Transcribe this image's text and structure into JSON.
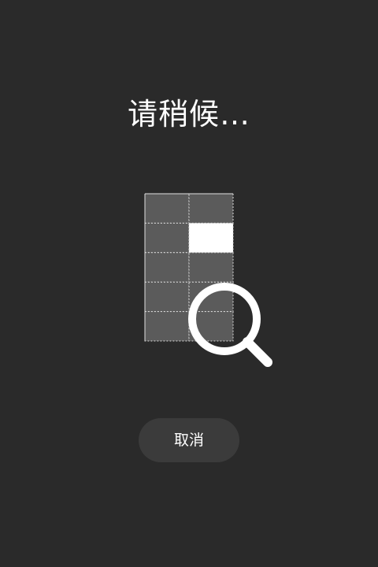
{
  "screen": {
    "title": "请稍候…"
  },
  "illustration": {
    "grid_columns": 2,
    "grid_rows": 5,
    "highlighted_cell": {
      "row": 2,
      "col": 2
    },
    "cell_color": "#5b5b5b",
    "highlight_color": "#ffffff",
    "icon": "magnifier-icon"
  },
  "actions": {
    "cancel_label": "取消"
  },
  "colors": {
    "background": "#2a2a2a",
    "button_background": "#3b3b3b",
    "text": "#ffffff"
  }
}
